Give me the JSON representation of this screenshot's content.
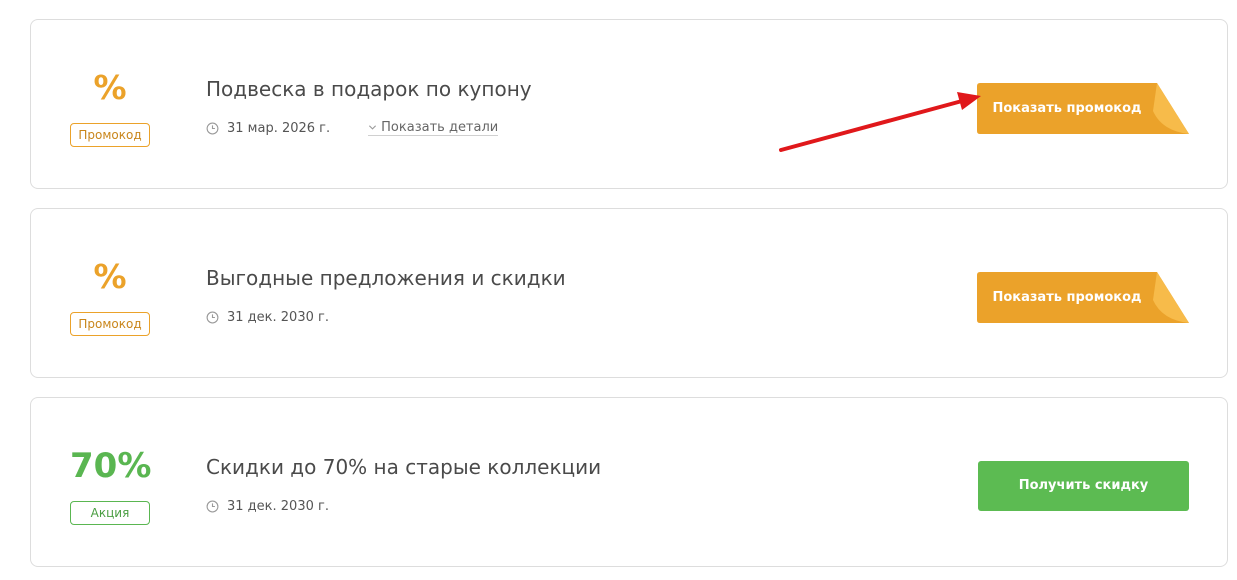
{
  "coupons": [
    {
      "value": "%",
      "type_label": "Промокод",
      "title": "Подвеска в подарок по купону",
      "date": "31 мар. 2026 г.",
      "details_label": "Показать детали",
      "button_label": "Показать промокод"
    },
    {
      "value": "%",
      "type_label": "Промокод",
      "title": "Выгодные предложения и скидки",
      "date": "31 дек. 2030 г.",
      "button_label": "Показать промокод"
    },
    {
      "value": "70%",
      "type_label": "Акция",
      "title": "Скидки до 70% на старые коллекции",
      "date": "31 дек. 2030 г.",
      "button_label": "Получить скидку"
    }
  ],
  "icons": {
    "clock": "clock-icon",
    "chevron": "chevron-down-icon",
    "annotation": "red-arrow-annotation"
  },
  "colors": {
    "promo_orange": "#eba22a",
    "promo_fold": "#f7bb4a",
    "deal_green": "#5cbb52",
    "annotation_red": "#e0181b",
    "card_border": "#dddddd"
  }
}
